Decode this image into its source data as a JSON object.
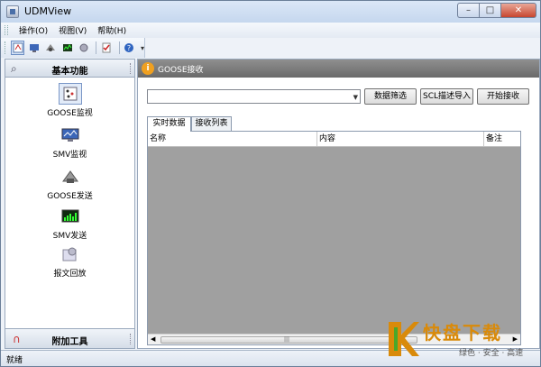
{
  "window": {
    "title": "UDMView"
  },
  "menu": {
    "items": [
      "操作(O)",
      "视图(V)",
      "帮助(H)"
    ]
  },
  "toolbar": {
    "icons": [
      "goose-monitor-icon",
      "smv-monitor-icon",
      "goose-send-icon",
      "smv-send-icon",
      "replay-icon",
      "check-icon",
      "help-icon"
    ]
  },
  "left_panel": {
    "header": "基本功能",
    "items": [
      {
        "label": "GOOSE监视",
        "icon": "goose-monitor-icon",
        "selected": true
      },
      {
        "label": "SMV监视",
        "icon": "smv-monitor-icon",
        "selected": false
      },
      {
        "label": "GOOSE发送",
        "icon": "goose-send-icon",
        "selected": false
      },
      {
        "label": "SMV发送",
        "icon": "smv-send-icon",
        "selected": false
      },
      {
        "label": "报文回放",
        "icon": "replay-icon",
        "selected": false
      }
    ],
    "footer": "附加工具"
  },
  "doc": {
    "title": "GOOSE接收",
    "combo_value": "",
    "buttons": {
      "filter": "数据筛选",
      "scl_import": "SCL描述导入",
      "start_receive": "开始接收"
    },
    "tabs": [
      {
        "label": "实时数据",
        "active": true
      },
      {
        "label": "接收列表",
        "active": false
      }
    ],
    "columns": [
      "名称",
      "内容",
      "备注"
    ]
  },
  "status": {
    "text": "就绪"
  },
  "watermark": {
    "title": "快盘下载",
    "subtitle": "绿色 · 安全 · 高速"
  },
  "colors": {
    "accent": "#d98a0a",
    "header_gray": "#7a7a7a",
    "grid_gray": "#a0a0a0"
  }
}
